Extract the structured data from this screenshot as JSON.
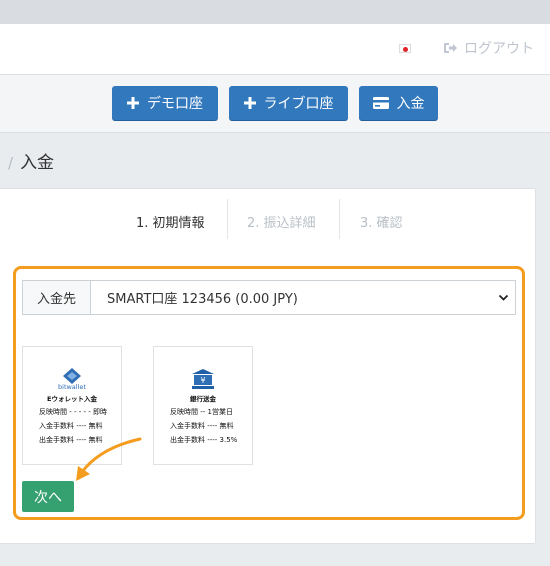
{
  "header": {
    "logout_label": "ログアウト",
    "flag_icon": "japan-flag-icon",
    "logout_icon": "logout-icon"
  },
  "toolbar": {
    "demo_label": "デモ口座",
    "live_label": "ライブ口座",
    "deposit_label": "入金"
  },
  "breadcrumb": {
    "current": "入金"
  },
  "steps": [
    {
      "label": "1. 初期情報",
      "active": true
    },
    {
      "label": "2. 振込詳細",
      "active": false
    },
    {
      "label": "3. 確認",
      "active": false
    }
  ],
  "form": {
    "destination_label": "入金先",
    "destination_value": "SMART口座 123456 (0.00 JPY)"
  },
  "methods": [
    {
      "brand": "bitwallet",
      "name": "Eウォレット入金",
      "rows": [
        "反映時間 - - - - - 即時",
        "入金手数料 ---- 無料",
        "出金手数料 ---- 無料"
      ]
    },
    {
      "brand": "",
      "name": "銀行送金",
      "rows": [
        "反映時間 -- 1営業日",
        "入金手数料 ---- 無料",
        "出金手数料 ---- 3.5%"
      ]
    }
  ],
  "next_label": "次へ",
  "colors": {
    "primary": "#3278bd",
    "success": "#36a170",
    "highlight": "#f39c1e"
  }
}
